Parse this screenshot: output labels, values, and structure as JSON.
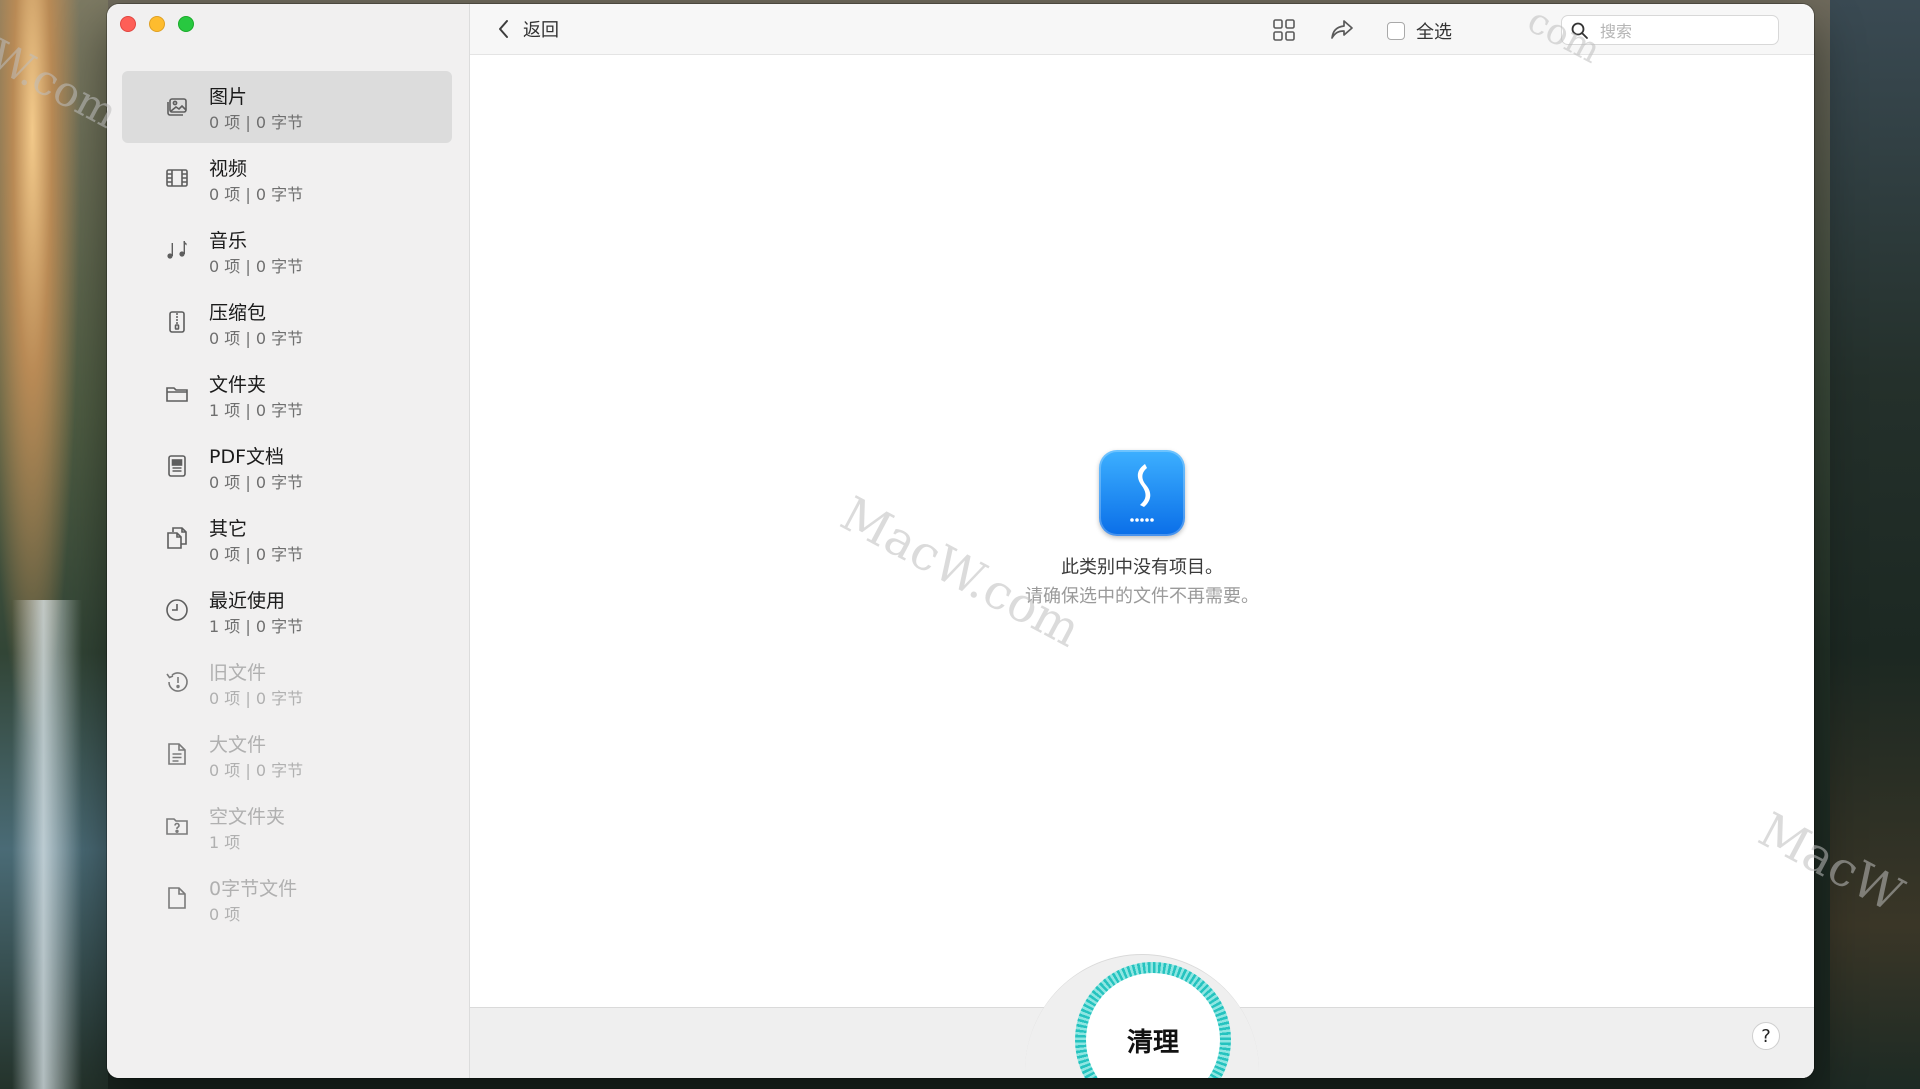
{
  "sidebar": {
    "categories": [
      {
        "name": "图片",
        "stat": "0 项 | 0 字节",
        "icon": "photo-icon"
      },
      {
        "name": "视频",
        "stat": "0 项 | 0 字节",
        "icon": "film-icon"
      },
      {
        "name": "音乐",
        "stat": "0 项 | 0 字节",
        "icon": "music-note-icon"
      },
      {
        "name": "压缩包",
        "stat": "0 项 | 0 字节",
        "icon": "zip-archive-icon"
      },
      {
        "name": "文件夹",
        "stat": "1 项 | 0 字节",
        "icon": "folder-icon"
      },
      {
        "name": "PDF文档",
        "stat": "0 项 | 0 字节",
        "icon": "pdf-document-icon"
      },
      {
        "name": "其它",
        "stat": "0 项 | 0 字节",
        "icon": "documents-icon"
      },
      {
        "name": "最近使用",
        "stat": "1 项 | 0 字节",
        "icon": "clock-icon"
      },
      {
        "name": "旧文件",
        "stat": "0 项 | 0 字节",
        "icon": "history-icon"
      },
      {
        "name": "大文件",
        "stat": "0 项 | 0 字节",
        "icon": "large-file-icon"
      },
      {
        "name": "空文件夹",
        "stat": "1 项",
        "icon": "empty-folder-icon"
      },
      {
        "name": "0字节文件",
        "stat": "0 项",
        "icon": "blank-file-icon"
      }
    ]
  },
  "toolbar": {
    "back_label": "返回",
    "select_all_label": "全选",
    "search_placeholder": "搜索"
  },
  "main": {
    "empty_title": "此类别中没有项目。",
    "empty_subtitle": "请确保选中的文件不再需要。",
    "clean_label": "清理",
    "help_label": "?"
  },
  "watermark": {
    "text_center": "MacW.com",
    "text_corner": "MacW",
    "text_left": "W.com",
    "text_top": "com"
  },
  "colors": {
    "accent_teal": "#25c3bf",
    "app_icon_blue": "#0a6ee8",
    "selection_gray": "#dcdcdc"
  }
}
